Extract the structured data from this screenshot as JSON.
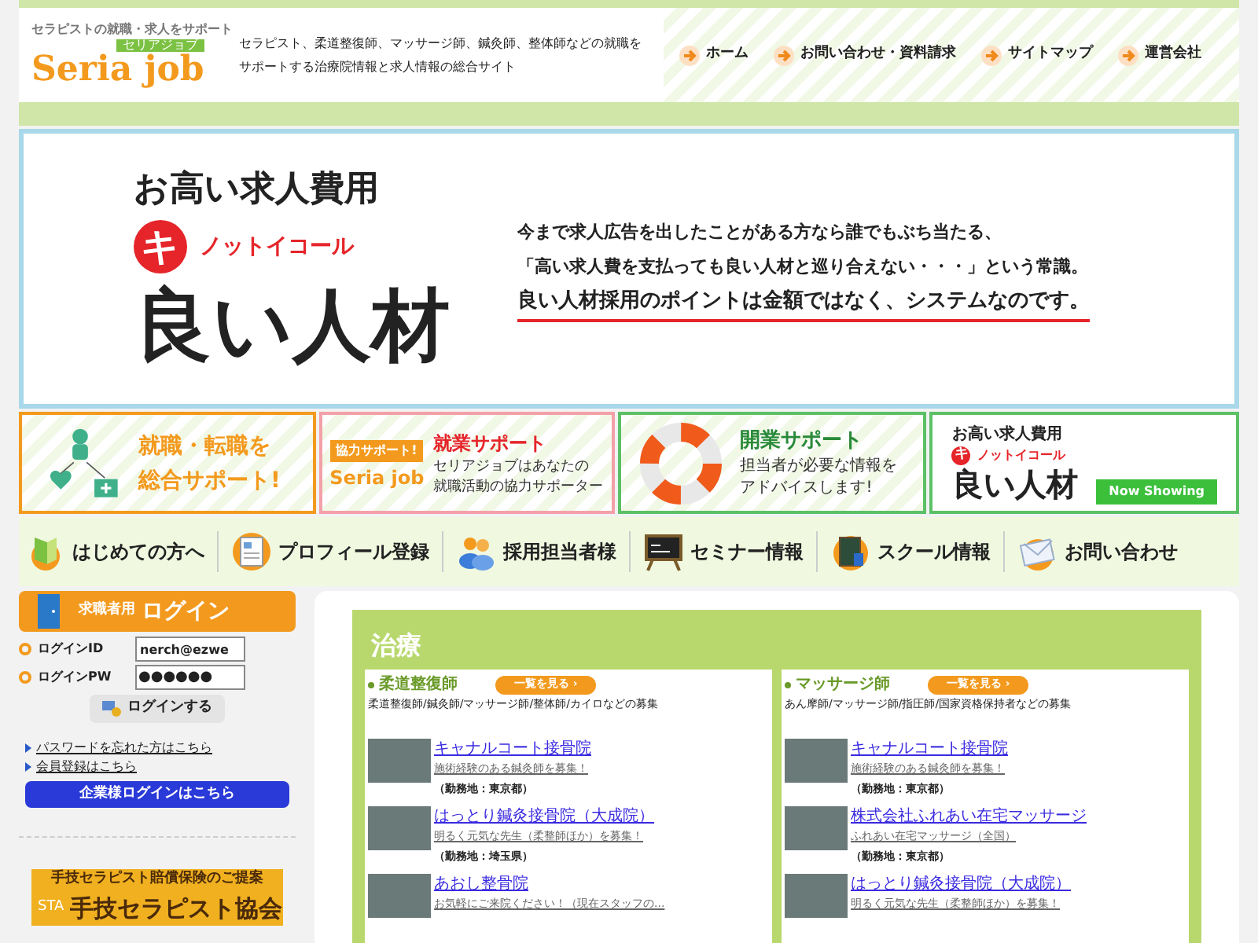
{
  "header": {
    "tagline": "セラピストの就職・求人をサポート",
    "logo_tag": "セリアジョブ",
    "logo_text": "Seria job",
    "description": [
      "セラピスト、柔道整復師、マッサージ師、鍼灸師、整体師などの就職を",
      "サポートする治療院情報と求人情報の総合サイト"
    ],
    "links": [
      "ホーム",
      "お問い合わせ・資料請求",
      "サイトマップ",
      "運営会社"
    ]
  },
  "hero": {
    "line1": "お高い求人費用",
    "mark": "キ",
    "not_equal": "ノットイコール",
    "line2": "良い人材",
    "body": [
      "今まで求人広告を出したことがある方なら誰でもぶち当たる、",
      "「高い求人費を支払っても良い人材と巡り合えない・・・」という常識。"
    ],
    "emphasis": "良い人材採用のポイントは金額ではなく、システムなのです。"
  },
  "banners": [
    {
      "kind": "support",
      "lines": [
        "就職・転職を",
        "総合サポート!"
      ]
    },
    {
      "kind": "work",
      "badge": "協力サポート!",
      "logo_text": "Seria job",
      "title": "就業サポート",
      "lines": [
        "セリアジョブはあなたの",
        "就職活動の協力サポーター"
      ]
    },
    {
      "kind": "open",
      "title": "開業サポート",
      "lines": [
        "担当者が必要な情報を",
        "アドバイスします!"
      ]
    },
    {
      "kind": "ad",
      "line1": "お高い求人費用",
      "mark": "キ",
      "not_equal": "ノットイコール",
      "line2": "良い人材",
      "badge": "Now Showing"
    }
  ],
  "nav": [
    "はじめての方へ",
    "プロフィール登録",
    "採用担当者様",
    "セミナー情報",
    "スクール情報",
    "お問い合わせ"
  ],
  "login": {
    "prefix": "求職者用",
    "title": "ログイン",
    "id_label": "ログインID",
    "id_value": "nerch@ezwe",
    "pw_label": "ログインPW",
    "pw_value": "●●●●●●",
    "button": "ログインする",
    "links": [
      "パスワードを忘れた方はこちら",
      "会員登録はこちら"
    ],
    "company_button": "企業様ログインはこちら"
  },
  "promo": {
    "title": "手技セラピスト賠償保険のご提案",
    "mark": "STA",
    "name": "手技セラピスト協会"
  },
  "section": {
    "title": "治療",
    "columns": [
      {
        "title": "柔道整復師",
        "button": "一覧を見る ›",
        "description": "柔道整復師/鍼灸師/マッサージ師/整体師/カイロなどの募集",
        "items": [
          {
            "name": "キャナルコート接骨院",
            "summary": "施術経験のある鍼灸師を募集！",
            "location": "（勤務地：東京都）"
          },
          {
            "name": "はっとり鍼灸接骨院（大成院）",
            "summary": "明るく元気な先生（柔整師ほか）を募集！",
            "location": "（勤務地：埼玉県）"
          },
          {
            "name": "あおし整骨院",
            "summary": "お気軽にご来院ください！（現在スタッフの..."
          }
        ]
      },
      {
        "title": "マッサージ師",
        "button": "一覧を見る ›",
        "description": "あん摩師/マッサージ師/指圧師/国家資格保持者などの募集",
        "items": [
          {
            "name": "キャナルコート接骨院",
            "summary": "施術経験のある鍼灸師を募集！",
            "location": "（勤務地：東京都）"
          },
          {
            "name": "株式会社ふれあい在宅マッサージ",
            "summary": "ふれあい在宅マッサージ（全国）",
            "location": "（勤務地：東京都）"
          },
          {
            "name": "はっとり鍼灸接骨院（大成院）",
            "summary": "明るく元気な先生（柔整師ほか）を募集！"
          }
        ]
      }
    ]
  }
}
